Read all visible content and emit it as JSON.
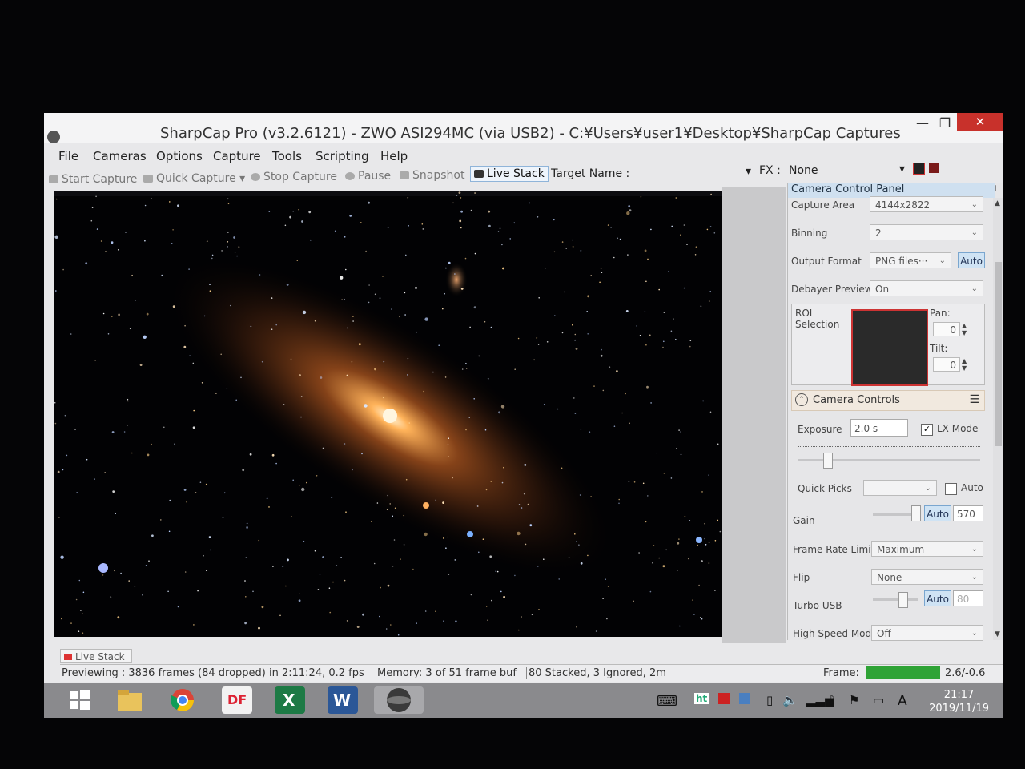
{
  "window": {
    "title": "SharpCap Pro (v3.2.6121) - ZWO ASI294MC (via USB2) - C:¥Users¥user1¥Desktop¥SharpCap Captures",
    "minimize": "—",
    "maximize": "❐",
    "close": "✕"
  },
  "menu": [
    "File",
    "Cameras",
    "Options",
    "Capture",
    "Tools",
    "Scripting",
    "Help"
  ],
  "toolbar": {
    "start_capture": "Start Capture",
    "quick_capture": "Quick Capture",
    "stop_capture": "Stop Capture",
    "pause": "Pause",
    "snapshot": "Snapshot",
    "live_stack": "Live Stack",
    "target_name_label": "Target Name :",
    "fx_label": "FX :",
    "fx_value": "None"
  },
  "panel": {
    "title": "Camera Control Panel",
    "capture_area_label": "Capture Area",
    "capture_area_value": "4144x2822",
    "binning_label": "Binning",
    "binning_value": "2",
    "output_format_label": "Output Format",
    "output_format_value": "PNG files···",
    "output_format_auto": "Auto",
    "debayer_label": "Debayer Preview",
    "debayer_value": "On",
    "roi_label": "ROI Selection",
    "pan_label": "Pan:",
    "pan_value": "0",
    "tilt_label": "Tilt:",
    "tilt_value": "0",
    "camera_controls_title": "Camera Controls",
    "exposure_label": "Exposure",
    "exposure_value": "2.0 s",
    "lx_mode_label": "LX Mode",
    "lx_mode_checked": true,
    "quick_picks_label": "Quick Picks",
    "quick_picks_auto": "Auto",
    "gain_label": "Gain",
    "gain_auto": "Auto",
    "gain_value": "570",
    "frame_rate_label": "Frame Rate Limit",
    "frame_rate_value": "Maximum",
    "flip_label": "Flip",
    "flip_value": "None",
    "turbo_usb_label": "Turbo USB",
    "turbo_usb_auto": "Auto",
    "turbo_usb_value": "80",
    "high_speed_label": "High Speed Mode",
    "high_speed_value": "Off"
  },
  "bottom": {
    "live_stack_tab": "Live Stack",
    "previewing": "Previewing : 3836 frames (84 dropped) in 2:11:24, 0.2 fps",
    "memory": "Memory: 3 of 51 frame buf",
    "stacked": "80 Stacked, 3 Ignored, 2m",
    "frame_label": "Frame:",
    "frame_value": "2.6/-0.6"
  },
  "taskbar": {
    "apps": [
      "start",
      "explorer",
      "chrome",
      "pdf",
      "excel",
      "word",
      "sharpcap"
    ],
    "pdf_label": "DF",
    "excel_label": "X",
    "word_label": "W",
    "lang": "A",
    "time": "21:17",
    "date": "2019/11/19"
  },
  "colors": {
    "close_red": "#c8312b",
    "accent_blue": "#cfe0f0",
    "frame_green": "#2fa336"
  }
}
